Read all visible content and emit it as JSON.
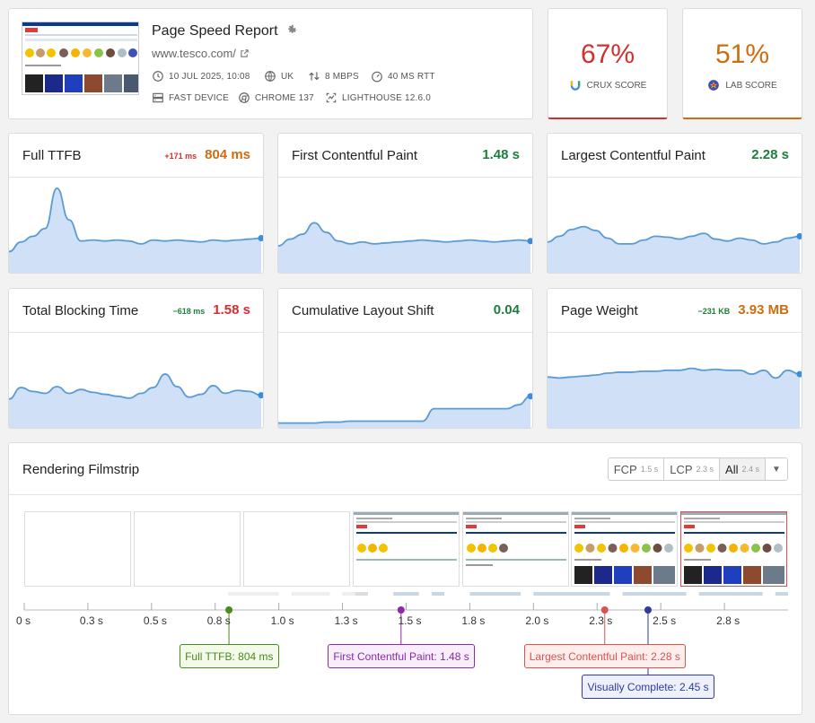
{
  "report": {
    "title": "Page Speed Report",
    "url": "www.tesco.com/",
    "meta": [
      {
        "icon": "clock-icon",
        "text": "10 JUL 2025, 10:08"
      },
      {
        "icon": "globe-icon",
        "text": "UK"
      },
      {
        "icon": "bandwidth-icon",
        "text": "8 MBPS"
      },
      {
        "icon": "speedometer-icon",
        "text": "40 MS RTT"
      },
      {
        "icon": "server-icon",
        "text": "FAST DEVICE"
      },
      {
        "icon": "chrome-icon",
        "text": "CHROME 137"
      },
      {
        "icon": "lighthouse-icon",
        "text": "LIGHTHOUSE 12.6.0"
      }
    ]
  },
  "scores": [
    {
      "value": "67%",
      "label": "CRUX SCORE",
      "color": "#d32f2f",
      "icon": "crux-icon"
    },
    {
      "value": "51%",
      "label": "LAB SCORE",
      "color": "#d06b10",
      "icon": "lab-icon"
    }
  ],
  "metrics": [
    {
      "title": "Full TTFB",
      "delta": "+171 ms",
      "delta_color": "#d32f2f",
      "value": "804 ms",
      "value_color": "#d06b10",
      "trend": [
        0.22,
        0.32,
        0.38,
        0.46,
        0.88,
        0.55,
        0.33,
        0.34,
        0.33,
        0.34,
        0.33,
        0.3,
        0.34,
        0.33,
        0.34,
        0.33,
        0.32,
        0.34,
        0.33,
        0.34,
        0.35,
        0.36
      ]
    },
    {
      "title": "First Contentful Paint",
      "delta": "",
      "delta_color": "#1a7f3c",
      "value": "1.48 s",
      "value_color": "#1a7f3c",
      "trend": [
        0.28,
        0.35,
        0.4,
        0.52,
        0.42,
        0.33,
        0.3,
        0.32,
        0.3,
        0.31,
        0.32,
        0.33,
        0.34,
        0.33,
        0.32,
        0.33,
        0.34,
        0.33,
        0.32,
        0.33,
        0.34,
        0.33
      ]
    },
    {
      "title": "Largest Contentful Paint",
      "delta": "",
      "delta_color": "#1a7f3c",
      "value": "2.28 s",
      "value_color": "#1a7f3c",
      "trend": [
        0.32,
        0.38,
        0.45,
        0.48,
        0.44,
        0.36,
        0.3,
        0.3,
        0.34,
        0.38,
        0.37,
        0.35,
        0.38,
        0.41,
        0.35,
        0.33,
        0.36,
        0.34,
        0.3,
        0.32,
        0.36,
        0.38
      ]
    },
    {
      "title": "Total Blocking Time",
      "delta": "−618 ms",
      "delta_color": "#1a7f3c",
      "value": "1.58 s",
      "value_color": "#d32f2f",
      "trend": [
        0.3,
        0.42,
        0.38,
        0.36,
        0.43,
        0.36,
        0.4,
        0.37,
        0.35,
        0.33,
        0.31,
        0.36,
        0.42,
        0.56,
        0.43,
        0.32,
        0.35,
        0.44,
        0.36,
        0.39,
        0.38,
        0.34
      ]
    },
    {
      "title": "Cumulative Layout Shift",
      "delta": "",
      "delta_color": "#1a7f3c",
      "value": "0.04",
      "value_color": "#1a7f3c",
      "trend": [
        0.05,
        0.05,
        0.05,
        0.05,
        0.06,
        0.06,
        0.07,
        0.07,
        0.07,
        0.07,
        0.07,
        0.07,
        0.07,
        0.2,
        0.2,
        0.2,
        0.2,
        0.2,
        0.2,
        0.2,
        0.24,
        0.33
      ]
    },
    {
      "title": "Page Weight",
      "delta": "−231 KB",
      "delta_color": "#1a7f3c",
      "value": "3.93 MB",
      "value_color": "#d06b10",
      "trend": [
        0.53,
        0.52,
        0.53,
        0.54,
        0.55,
        0.57,
        0.58,
        0.58,
        0.59,
        0.59,
        0.6,
        0.6,
        0.62,
        0.6,
        0.61,
        0.6,
        0.6,
        0.56,
        0.6,
        0.52,
        0.6,
        0.56
      ]
    }
  ],
  "filmstrip": {
    "title": "Rendering Filmstrip",
    "options": [
      {
        "label": "FCP",
        "time": "1.5 s",
        "active": false
      },
      {
        "label": "LCP",
        "time": "2.3 s",
        "active": false
      },
      {
        "label": "All",
        "time": "2.4 s",
        "active": true
      }
    ],
    "ticks": [
      "0 s",
      "0.3 s",
      "0.5 s",
      "0.8 s",
      "1.0 s",
      "1.3 s",
      "1.5 s",
      "1.8 s",
      "2.0 s",
      "2.3 s",
      "2.5 s",
      "2.8 s"
    ],
    "markers": [
      {
        "label": "Full TTFB: 804 ms",
        "time": 0.804,
        "color": "#4a8a1f",
        "bg": "#f3fae9",
        "row": 0
      },
      {
        "label": "First Contentful Paint: 1.48 s",
        "time": 1.48,
        "color": "#8a2aa8",
        "bg": "#f8eefb",
        "row": 0
      },
      {
        "label": "Largest Contentful Paint: 2.28 s",
        "time": 2.28,
        "color": "#d9534f",
        "bg": "#fdeeee",
        "row": 0
      },
      {
        "label": "Visually Complete: 2.45 s",
        "time": 2.45,
        "color": "#2f3c9a",
        "bg": "#eef0fb",
        "row": 1
      }
    ],
    "frames": [
      {
        "type": "blank"
      },
      {
        "type": "blank"
      },
      {
        "type": "blank"
      },
      {
        "type": "partial"
      },
      {
        "type": "partial2"
      },
      {
        "type": "full"
      },
      {
        "type": "full",
        "highlight": true
      },
      {
        "type": "full"
      }
    ]
  }
}
